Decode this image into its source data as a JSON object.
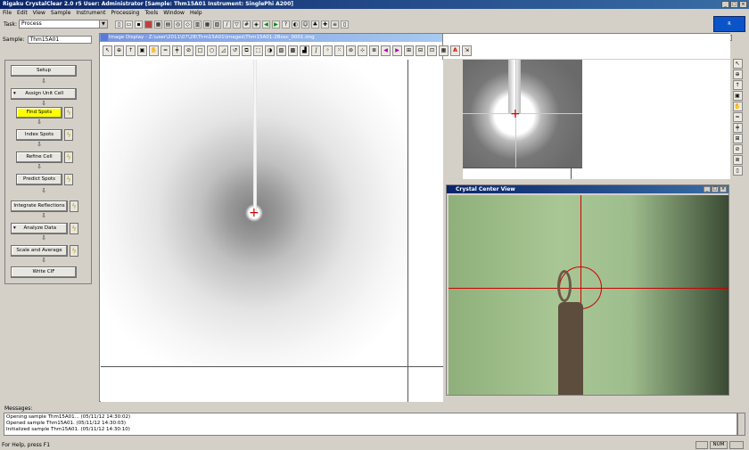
{
  "title_bar": "Rigaku CrystalClear 2.0 r5   User: Administrator   [Sample: Thm15A01   Instrument: SinglePhi A200]",
  "menu": [
    "File",
    "Edit",
    "View",
    "Sample",
    "Instrument",
    "Processing",
    "Tools",
    "Window",
    "Help"
  ],
  "task": {
    "label": "Task:",
    "value": "Process"
  },
  "logo": "R",
  "sample": {
    "label": "Sample:",
    "value": "Thm15A01"
  },
  "workflow": {
    "setup": "Setup",
    "assign_unit_cell": "Assign Unit Cell",
    "find_spots": "Find Spots",
    "index_spots": "Index Spots",
    "refine_cell": "Refine Cell",
    "predict_spots": "Predict Spots",
    "integrate_reflections": "Integrate Reflections",
    "analyze_data": "Analyze Data",
    "scale_and_average": "Scale and Average",
    "write_cif": "Write CIF"
  },
  "image_display": {
    "title": "Image Display - Z:\\user\\2011\\07\\28\\Thm15A01\\images\\Thm15A01-2Bosc_0001.img"
  },
  "crystal_center": {
    "title": "Crystal Center View"
  },
  "messages": {
    "label": "Messages:",
    "lines": [
      "Opening sample Thm15A01... (05/11/12 14:30:02)",
      "Opened sample Thm15A01. (05/11/12 14:30:03)",
      "Initialized sample Thm15A01. (05/11/12 14:30:10)"
    ]
  },
  "status": {
    "help": "For Help, press F1",
    "num": "NUM"
  }
}
